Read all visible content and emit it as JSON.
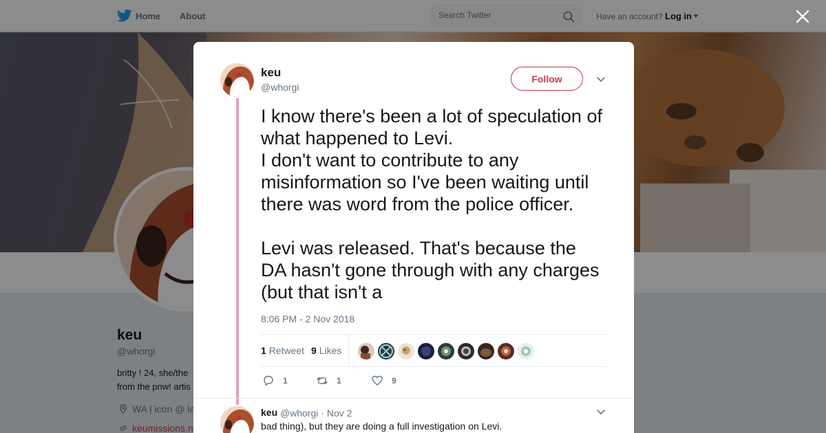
{
  "nav": {
    "home": "Home",
    "about": "About",
    "search_placeholder": "Search Twitter",
    "have_account": "Have an account?",
    "login": "Log in"
  },
  "profile": {
    "name": "keu",
    "handle": "@whorgi",
    "bio_line1": "britty ! 24, she/the",
    "bio_line2": "from the pnw! artis",
    "location": "WA | icon @ la",
    "link": "keumissions.n"
  },
  "tweet": {
    "name": "keu",
    "handle": "@whorgi",
    "follow_label": "Follow",
    "text": "I know there's been a lot of speculation of what happened to Levi.\nI don't want to contribute to any misinformation so I've been waiting until there was word from the police officer.\n\nLevi was released. That's because the DA hasn't gone through with any charges (but that isn't a",
    "timestamp": "8:06 PM - 2 Nov 2018",
    "retweets_count": "1",
    "retweets_label": "Retweet",
    "likes_count": "9",
    "likes_label": "Likes",
    "reply_count": "1",
    "retweet_action_count": "1",
    "like_action_count": "9"
  },
  "reply": {
    "name": "keu",
    "meta": "@whorgi · Nov 2",
    "text": "bad thing), but they are doing a full investigation on Levi."
  },
  "colors": {
    "accent": "#c0394f",
    "thread_line": "#e0a0b0",
    "twitter_blue": "#1da1f2"
  }
}
